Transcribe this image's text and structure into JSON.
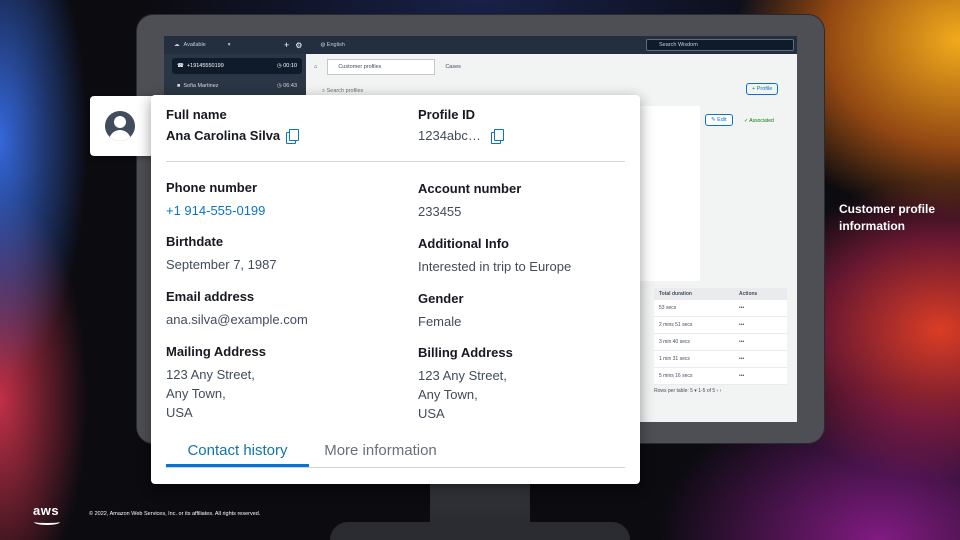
{
  "background_screen": {
    "topbar": {
      "status": "Available",
      "language": "English",
      "search_placeholder": "Search Wisdom"
    },
    "contacts": [
      {
        "number": "+19145550199",
        "time": "00:10"
      },
      {
        "name": "Sofia Martinez",
        "time": "06:43"
      }
    ],
    "tabs": [
      {
        "label": "Customer profiles"
      },
      {
        "label": "Cases"
      }
    ],
    "search_profiles": "Search profiles",
    "profile_button": "+ Profile",
    "edit_button": "Edit",
    "associated_label": "✓ Associated",
    "table": {
      "headers": [
        "Total duration",
        "Actions"
      ],
      "rows": [
        [
          "53 secs",
          "•••"
        ],
        [
          "2 mins 51 secs",
          "•••"
        ],
        [
          "3 min 40 secs",
          "•••"
        ],
        [
          "1 min 31 secs",
          "•••"
        ],
        [
          "5 mins 16 secs",
          "•••"
        ]
      ],
      "pager": "Rows per table: 5 ▾   1-5 of 5   ‹   ›"
    }
  },
  "profile_card": {
    "full_name": {
      "label": "Full name",
      "value": "Ana Carolina Silva"
    },
    "profile_id": {
      "label": "Profile ID",
      "value": "1234abc…"
    },
    "phone": {
      "label": "Phone number",
      "value": "+1 914-555-0199"
    },
    "account": {
      "label": "Account number",
      "value": "233455"
    },
    "birthdate": {
      "label": "Birthdate",
      "value": "September 7, 1987"
    },
    "additional": {
      "label": "Additional Info",
      "value": "Interested in trip to Europe"
    },
    "email": {
      "label": "Email address",
      "value": "ana.silva@example.com"
    },
    "gender": {
      "label": "Gender",
      "value": "Female"
    },
    "mailing": {
      "label": "Mailing Address",
      "lines": [
        "123 Any Street,",
        "Any Town,",
        "USA"
      ]
    },
    "billing": {
      "label": "Billing Address",
      "lines": [
        "123 Any Street,",
        "Any Town,",
        "USA"
      ]
    },
    "tabs": [
      {
        "label": "Contact history"
      },
      {
        "label": "More information"
      }
    ]
  },
  "caption": "Customer profile information",
  "footer": {
    "logo": "aws",
    "copyright": "© 2022, Amazon Web Services, Inc. or its affiliates. All rights reserved."
  },
  "colors": {
    "link": "#0972d3",
    "accent_tab": "#0f76ab",
    "success": "#037f0c"
  }
}
